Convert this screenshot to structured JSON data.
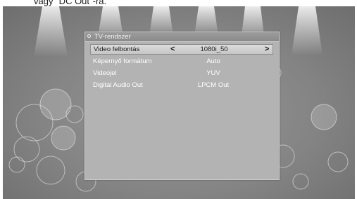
{
  "caption": "vagy \"DC Out\"-ra.",
  "panel": {
    "title": "TV-rendszer"
  },
  "rows": [
    {
      "label": "Video felbontás",
      "value": "1080i_50",
      "left_arrow": "<",
      "right_arrow": ">"
    },
    {
      "label": "Képernyő formátum",
      "value": "Auto"
    },
    {
      "label": "Videojel",
      "value": "YUV"
    },
    {
      "label": "Digital Audio Out",
      "value": "LPCM Out"
    }
  ]
}
